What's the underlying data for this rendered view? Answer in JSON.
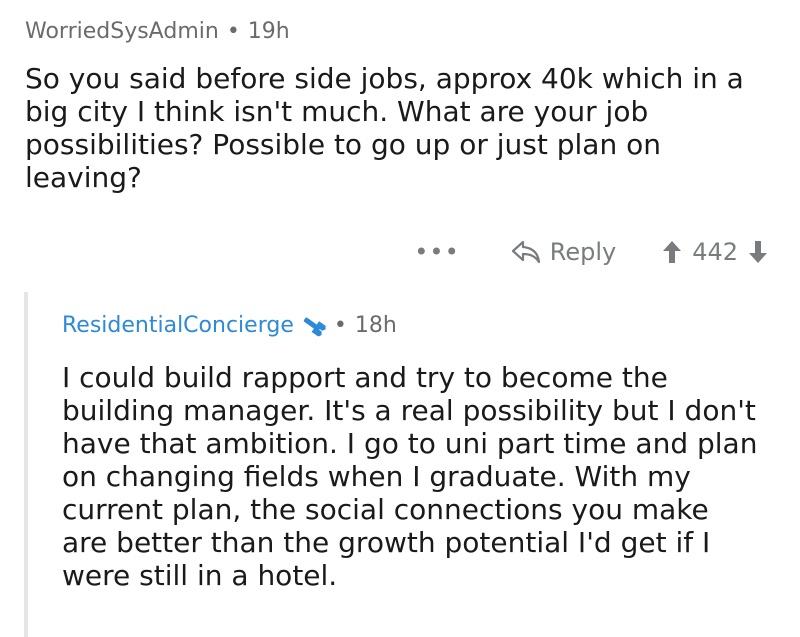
{
  "parent_comment": {
    "author": "WorriedSysAdmin",
    "separator": "•",
    "age": "19h",
    "body": "So you said before side jobs, approx 40k which in a big city I think isn't much. What are your job possibilities? Possible to go up or just plan on leaving?",
    "more_label": "•••",
    "reply_label": "Reply",
    "score": "442"
  },
  "reply_comment": {
    "author": "ResidentialConcierge",
    "flair_icon": "wrench-icon",
    "separator": "•",
    "age": "18h",
    "body": "I could build rapport and try to become the building manager. It's a real possibility but I don't have that ambition. I go to uni part time and plan on changing fields when I graduate. With my current plan, the social connections you make are better than the growth potential I'd get if I were still in a hotel."
  },
  "colors": {
    "author_link": "#2e89d9",
    "meta_gray": "#6b6b6b",
    "action_gray": "#787c7e",
    "thread_line": "#e6e6e6"
  }
}
